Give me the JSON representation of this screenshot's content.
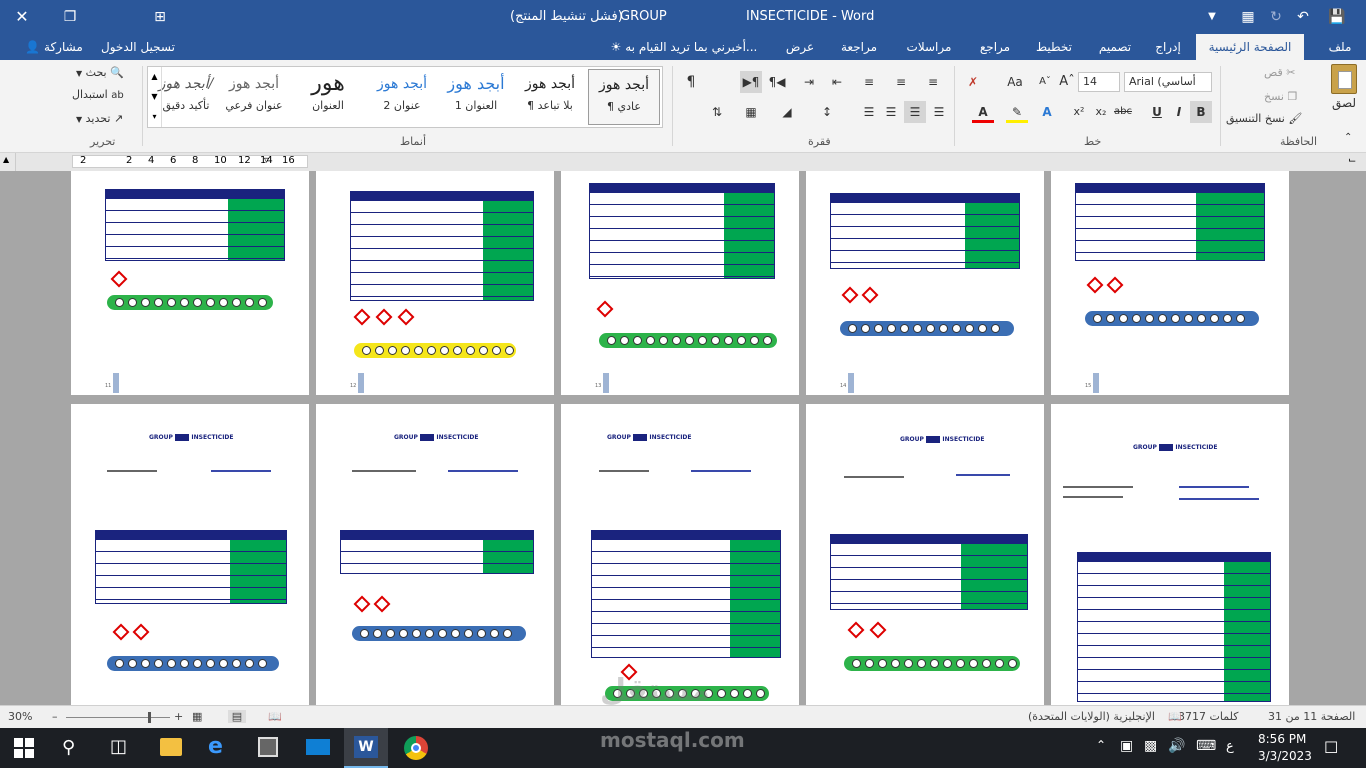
{
  "titlebar": {
    "title": "INSECTICIDE - Word",
    "group_label": "GROUP",
    "activation_warning": "(فشل تنشيط المنتج)"
  },
  "tabs": {
    "file": "ملف",
    "home": "الصفحة الرئيسية",
    "insert": "إدراج",
    "design": "تصميم",
    "layout": "تخطيط",
    "references": "مراجع",
    "mailings": "مراسلات",
    "review": "مراجعة",
    "view": "عرض",
    "tell_me": "أخبرني بما تريد القيام به...",
    "sign_in": "تسجيل الدخول",
    "share": "مشاركة"
  },
  "clipboard": {
    "paste": "لصق",
    "cut": "قص",
    "copy": "نسخ",
    "format_painter": "نسخ التنسيق",
    "group_label": "الحافظة"
  },
  "font": {
    "name": "Arial (أساسي",
    "size": "14",
    "group_label": "خط"
  },
  "paragraph": {
    "group_label": "فقرة"
  },
  "styles": {
    "group_label": "أنماط",
    "items": [
      {
        "preview": "أبجد هوز",
        "name": "¶ عادي"
      },
      {
        "preview": "أبجد هوز",
        "name": "¶ بلا تباعد"
      },
      {
        "preview": "أبجد هوز",
        "name": "العنوان 1"
      },
      {
        "preview": "أبجد هوز",
        "name": "عنوان 2"
      },
      {
        "preview": "هور",
        "name": "العنوان"
      },
      {
        "preview": "أبجد هوز",
        "name": "عنوان فرعي"
      },
      {
        "preview": "أبجد هوز/",
        "name": "تأكيد دقيق"
      }
    ]
  },
  "editing": {
    "find": "بحث",
    "replace": "استبدال",
    "select": "تحديد",
    "group_label": "تحرير"
  },
  "ruler": {
    "ticks": [
      "2",
      "2",
      "4",
      "6",
      "8",
      "10",
      "12",
      "14",
      "16"
    ]
  },
  "doc_pages": {
    "group_title": "GROUP",
    "insecticide_title": "INSECTICIDE",
    "page_numbers": [
      "11",
      "12",
      "13",
      "14",
      "15"
    ]
  },
  "statusbar": {
    "page": "الصفحة 11 من 31",
    "words": "3717 كلمات",
    "language": "الإنجليزية (الولايات المتحدة)",
    "zoom": "30%"
  },
  "taskbar": {
    "time": "8:56 PM",
    "date": "3/3/2023",
    "lang": "ع"
  },
  "watermark": {
    "brand": "مستقل",
    "url": "mostaql.com"
  }
}
